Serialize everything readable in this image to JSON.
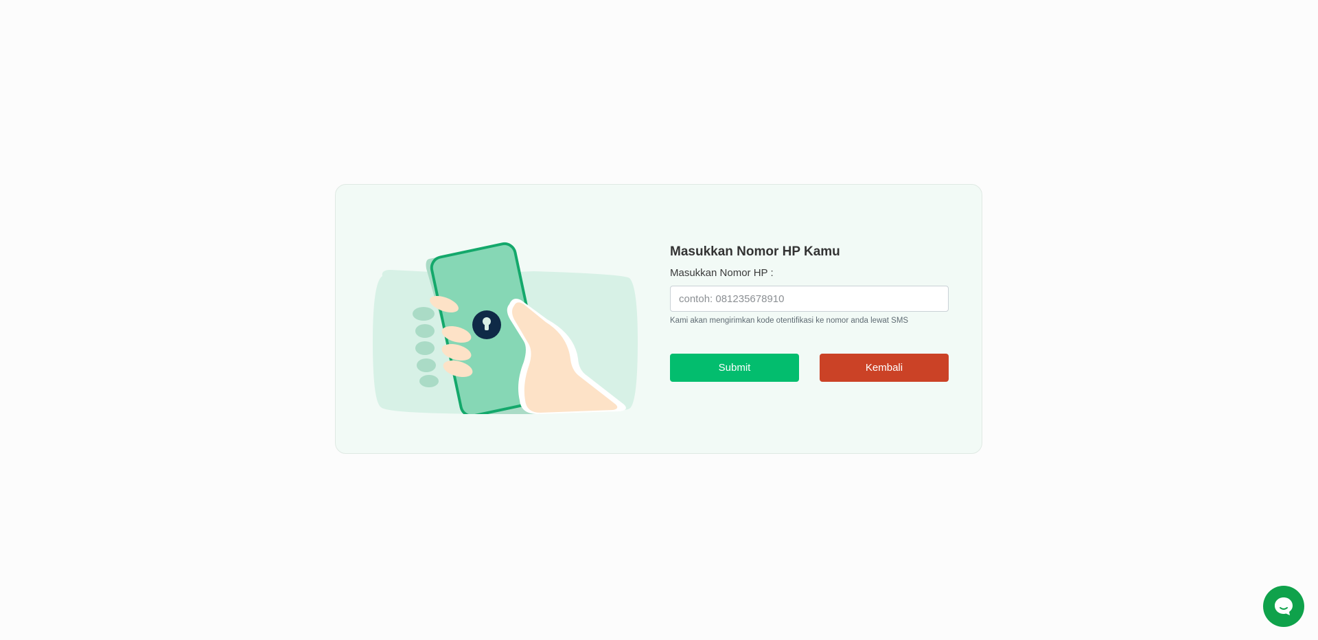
{
  "form": {
    "title": "Masukkan Nomor HP Kamu",
    "phone_label": "Masukkan Nomor HP :",
    "phone_value": "",
    "phone_placeholder": "contoh: 081235678910",
    "hint": "Kami akan mengirimkan kode otentifikasi ke nomor anda lewat SMS"
  },
  "buttons": {
    "submit_label": "Submit",
    "back_label": "Kembali"
  },
  "icons": {
    "illustration": "hand-holding-phone-with-lock-icon",
    "chat": "chat-bubble-icon"
  },
  "colors": {
    "submit": "#03bd6e",
    "back": "#cb4226",
    "chat": "#0fa24b",
    "card_background": "#f2faf6"
  }
}
